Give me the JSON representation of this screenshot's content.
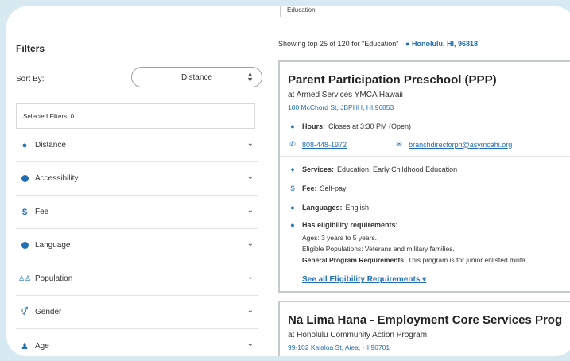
{
  "search": {
    "value": "Education"
  },
  "filters": {
    "title": "Filters",
    "sort_label": "Sort By:",
    "sort_value": "Distance",
    "selected_label": "Selected Filters: 0",
    "items": [
      {
        "label": "Distance",
        "icon": "location-pin-icon"
      },
      {
        "label": "Accessibility",
        "icon": "accessibility-icon"
      },
      {
        "label": "Fee",
        "icon": "dollar-icon"
      },
      {
        "label": "Language",
        "icon": "globe-icon"
      },
      {
        "label": "Population",
        "icon": "people-icon"
      },
      {
        "label": "Gender",
        "icon": "gender-icon"
      },
      {
        "label": "Age",
        "icon": "person-age-icon"
      }
    ]
  },
  "results": {
    "showing_text": "Showing top 25 of 120 for \"Education\"",
    "location": "Honolulu, HI, 96818",
    "cards": [
      {
        "title": "Parent Participation Preschool (PPP)",
        "org": "at Armed Services YMCA Hawaii",
        "address": "100 McChord St, JBPHH, HI 96853",
        "hours_label": "Hours:",
        "hours_value": "Closes at 3:30 PM (Open)",
        "phone": "808-448-1972",
        "email": "branchdirectorph@asymcahi.org",
        "services_label": "Services:",
        "services_value": "Education, Early Childhood Education",
        "fee_label": "Fee:",
        "fee_value": "Self-pay",
        "languages_label": "Languages:",
        "languages_value": "English",
        "eligibility_label": "Has eligibility requirements:",
        "eligibility_ages": "Ages: 3 years to 5 years.",
        "eligibility_populations": "Eligible Populations: Veterans and military families.",
        "general_label": "General Program Requirements:",
        "general_value": "This program is for junior enlisted milita",
        "see_all": "See all Eligibility Requirements"
      },
      {
        "title": "Nā Lima Hana - Employment Core Services Prog",
        "org": "at Honolulu Community Action Program",
        "address": "99-102 Kalaloa St, Aiea, HI 96701"
      }
    ]
  },
  "colors": {
    "accent": "#1f6fb4",
    "frame": "#d7eaf2"
  }
}
